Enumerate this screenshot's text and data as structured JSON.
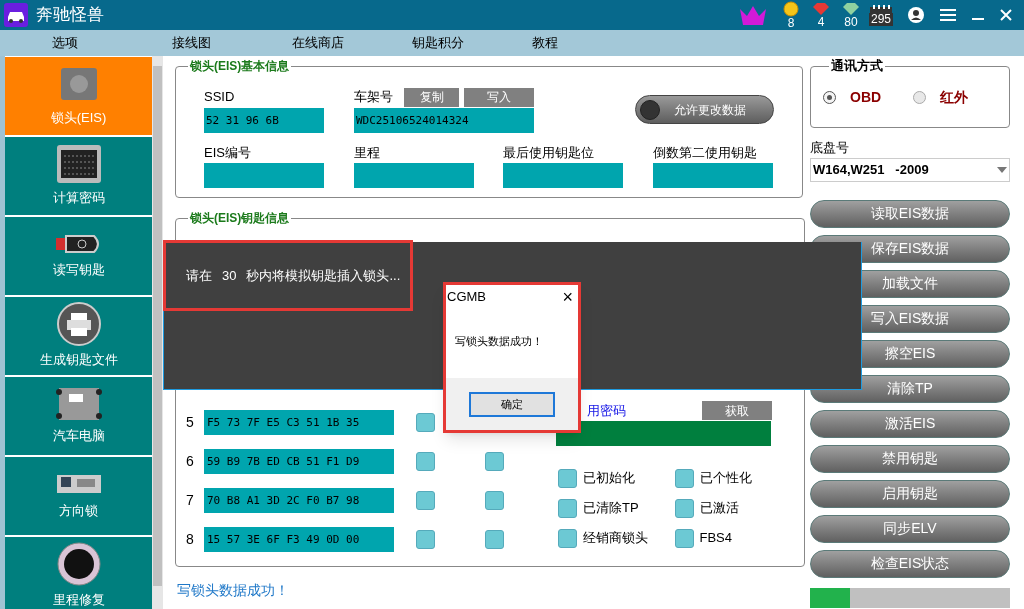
{
  "window": {
    "title": "奔驰怪兽",
    "stats": [
      {
        "kind": "coin",
        "value": "8"
      },
      {
        "kind": "ruby",
        "value": "4"
      },
      {
        "kind": "diamond",
        "value": "80"
      },
      {
        "kind": "calendar",
        "value": "295"
      }
    ]
  },
  "menu": [
    "选项",
    "接线图",
    "在线商店",
    "钥匙积分",
    "教程"
  ],
  "sidebar": {
    "items": [
      {
        "label": "锁头(EIS)",
        "kind": "eis",
        "selected": true
      },
      {
        "label": "计算密码",
        "kind": "binary",
        "selected": false
      },
      {
        "label": "读写钥匙",
        "kind": "key",
        "selected": false
      },
      {
        "label": "生成钥匙文件",
        "kind": "printer",
        "selected": false
      },
      {
        "label": "汽车电脑",
        "kind": "ecu",
        "selected": false
      },
      {
        "label": "方向锁",
        "kind": "lock",
        "selected": false
      },
      {
        "label": "里程修复",
        "kind": "gauge",
        "selected": false
      }
    ]
  },
  "basic_info": {
    "title": "锁头(EIS)基本信息",
    "ssid": {
      "label": "SSID",
      "value": "52 31 96 6B"
    },
    "vin": {
      "label": "车架号",
      "value": "WDC25106524014324",
      "buttons": [
        "复制",
        "写入"
      ]
    },
    "allow_change": {
      "label": "允许更改数据",
      "on": false
    },
    "fields": [
      {
        "label": "EIS编号"
      },
      {
        "label": "里程"
      },
      {
        "label": "最后使用钥匙位"
      },
      {
        "label": "倒数第二使用钥匙"
      }
    ]
  },
  "key_info": {
    "title": "锁头(EIS)钥匙信息",
    "rows": [
      {
        "index": "5",
        "value": "F5 73 7F E5 C3 51 1B 35",
        "flags": [
          false
        ]
      },
      {
        "index": "6",
        "value": "59 B9 7B ED CB 51 F1 D9",
        "flags": [
          false,
          false
        ]
      },
      {
        "index": "7",
        "value": "70 B8 A1 3D 2C F0 B7 98",
        "flags": [
          false,
          false
        ]
      },
      {
        "index": "8",
        "value": "15 57 3E 6F F3 49 0D 00",
        "flags": [
          false,
          false
        ]
      }
    ],
    "password": {
      "label": "用密码",
      "button": "获取"
    },
    "status_flags": [
      {
        "label": "已初始化",
        "checked": false
      },
      {
        "label": "已个性化",
        "checked": false
      },
      {
        "label": "已清除TP",
        "checked": false
      },
      {
        "label": "已激活",
        "checked": false
      },
      {
        "label": "经销商锁头",
        "checked": false
      },
      {
        "label": "FBS4",
        "checked": false
      }
    ]
  },
  "status_bar": "写锁头数据成功！",
  "progress": {
    "level": 0.2
  },
  "comm": {
    "title": "通讯方式",
    "options": [
      {
        "label": "OBD",
        "selected": true
      },
      {
        "label": "红外",
        "selected": false
      }
    ]
  },
  "chassis": {
    "label": "底盘号",
    "value": "W164,W251   -2009"
  },
  "actions": [
    "读取EIS数据",
    "保存EIS数据",
    "加载文件",
    "写入EIS数据",
    "擦空EIS",
    "清除TP",
    "激活EIS",
    "禁用钥匙",
    "启用钥匙",
    "同步ELV",
    "检查EIS状态"
  ],
  "overlay": {
    "prefix": "请在",
    "seconds": "30",
    "suffix": "秒内将模拟钥匙插入锁头..."
  },
  "dialog": {
    "title": "CGMB",
    "close": "×",
    "message": "写锁头数据成功！",
    "button": "确定"
  }
}
